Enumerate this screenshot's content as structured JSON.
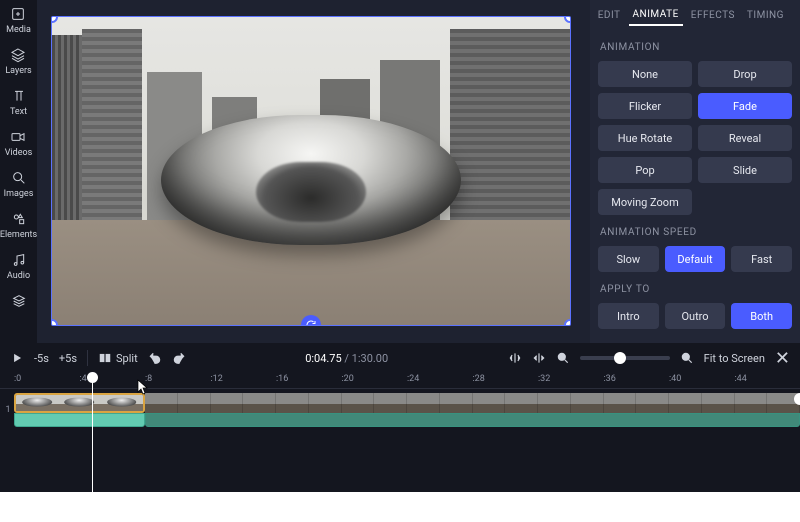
{
  "rail": {
    "items": [
      {
        "name": "Media"
      },
      {
        "name": "Layers"
      },
      {
        "name": "Text"
      },
      {
        "name": "Videos"
      },
      {
        "name": "Images"
      },
      {
        "name": "Elements"
      },
      {
        "name": "Audio"
      }
    ]
  },
  "tabs": {
    "items": [
      "EDIT",
      "ANIMATE",
      "EFFECTS",
      "TIMING"
    ],
    "active": "ANIMATE"
  },
  "panel": {
    "animation_label": "ANIMATION",
    "animations": [
      "None",
      "Drop",
      "Flicker",
      "Fade",
      "Hue Rotate",
      "Reveal",
      "Pop",
      "Slide",
      "Moving Zoom"
    ],
    "animation_active": "Fade",
    "speed_label": "ANIMATION SPEED",
    "speeds": [
      "Slow",
      "Default",
      "Fast"
    ],
    "speed_active": "Default",
    "apply_label": "APPLY TO",
    "apply": [
      "Intro",
      "Outro",
      "Both"
    ],
    "apply_active": "Both"
  },
  "toolbar": {
    "back5": "-5s",
    "fwd5": "+5s",
    "split": "Split",
    "time_current": "0:04.75",
    "time_sep": " / ",
    "time_duration": "1:30.00",
    "fit": "Fit to Screen"
  },
  "timeline": {
    "ticks": [
      ":0",
      ":4",
      ":8",
      ":12",
      ":16",
      ":20",
      ":24",
      ":28",
      ":32",
      ":36",
      ":40",
      ":44"
    ],
    "track_number": "1",
    "playhead_seconds": 4.75,
    "selected_clip_end_seconds": 8
  }
}
